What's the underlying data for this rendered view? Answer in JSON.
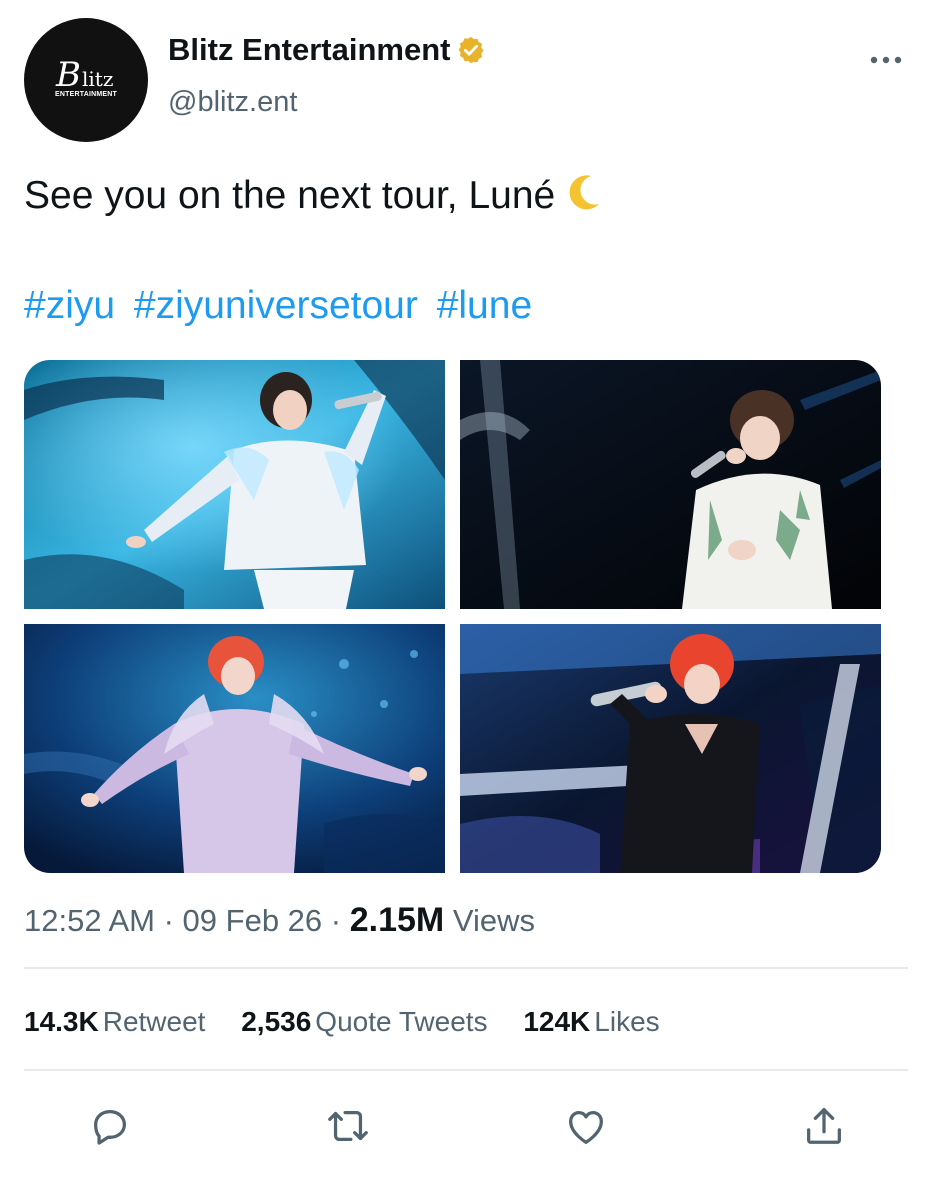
{
  "account": {
    "avatar_text_main": "B",
    "avatar_text_rest": "litz",
    "avatar_subtext": "ENTERTAINMENT",
    "display_name": "Blitz Entertainment",
    "handle": "@blitz.ent",
    "verified_icon": "gold-verified-badge-icon",
    "more_icon": "more-horizontal-icon"
  },
  "tweet": {
    "text": "See you on the next tour, Luné",
    "emoji_icon": "crescent-moon-emoji",
    "hashtags": [
      "#ziyu",
      "#ziyuniversetour",
      "#lune"
    ]
  },
  "media": [
    {
      "name": "photo-1"
    },
    {
      "name": "photo-2"
    },
    {
      "name": "photo-3"
    },
    {
      "name": "photo-4"
    }
  ],
  "meta": {
    "time": "12:52 AM",
    "separator": " · ",
    "date": "09 Feb 26",
    "views_count": "2.15M",
    "views_label": "Views"
  },
  "stats": {
    "retweets_count": "14.3K",
    "retweets_label": "Retweet",
    "quotes_count": "2,536",
    "quotes_label": "Quote Tweets",
    "likes_count": "124K",
    "likes_label": "Likes"
  },
  "actions": {
    "reply_icon": "reply-icon",
    "retweet_icon": "retweet-icon",
    "like_icon": "heart-icon",
    "share_icon": "share-icon"
  },
  "colors": {
    "link": "#1d9bf0",
    "secondary_text": "#536471",
    "primary_text": "#0f1419",
    "verified_gold": "#e8b32b"
  }
}
